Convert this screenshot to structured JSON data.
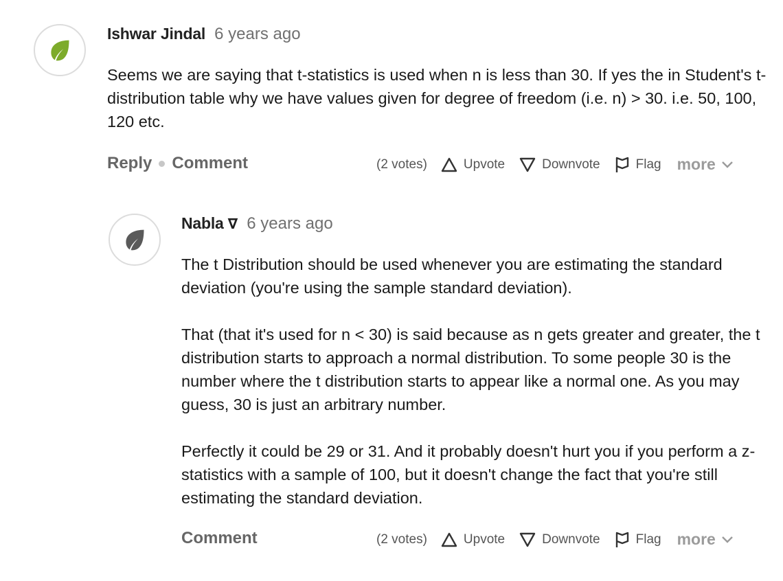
{
  "comments": [
    {
      "author": "Ishwar Jindal",
      "time": "6 years ago",
      "avatar_icon": "leaf-icon",
      "avatar_color": "#7dab2b",
      "paragraphs": [
        "Seems we are saying that t-statistics is used when n is less than 30. If yes the in Student's t-distribution table why we have values given for degree of freedom (i.e. n) > 30. i.e. 50, 100, 120 etc."
      ],
      "actions": {
        "reply": "Reply",
        "comment": "Comment",
        "votes": "(2 votes)",
        "upvote": "Upvote",
        "downvote": "Downvote",
        "flag": "Flag",
        "more": "more"
      }
    },
    {
      "author": "Nabla",
      "author_badge": "∇",
      "time": "6 years ago",
      "avatar_icon": "leaf-icon",
      "avatar_color": "#5a5a5a",
      "paragraphs": [
        "The t Distribution should be used whenever you are estimating the standard deviation (you're using the sample standard deviation).",
        "That (that it's used for n < 30) is said because as n gets greater and greater, the t distribution starts to approach a normal distribution. To some people 30 is the number where the t distribution starts to appear like a normal one. As you may guess, 30 is just an arbitrary number.",
        "Perfectly it could be 29 or 31. And it probably doesn't hurt you if you perform a z-statistics with a sample of 100, but it doesn't change the fact that you're still estimating the standard deviation."
      ],
      "actions": {
        "comment": "Comment",
        "votes": "(2 votes)",
        "upvote": "Upvote",
        "downvote": "Downvote",
        "flag": "Flag",
        "more": "more"
      }
    }
  ]
}
